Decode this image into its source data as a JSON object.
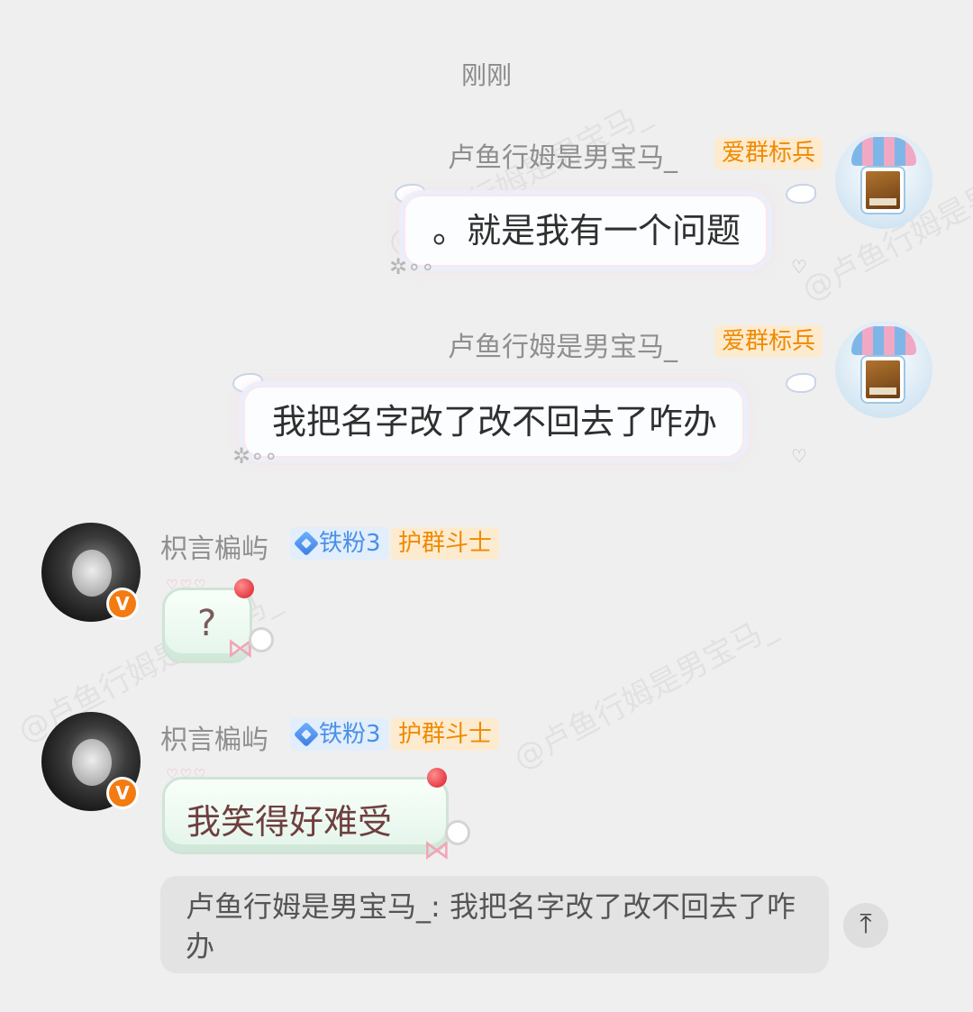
{
  "timestamp": "刚刚",
  "watermark": "@卢鱼行姆是男宝马_",
  "messages": [
    {
      "sender": "卢鱼行姆是男宝马_",
      "badge": "爱群标兵",
      "text": "。就是我有一个问题"
    },
    {
      "sender": "卢鱼行姆是男宝马_",
      "badge": "爱群标兵",
      "text": "我把名字改了改不回去了咋办"
    },
    {
      "sender": "枳言楄屿",
      "fan_badge": "铁粉3",
      "badge": "护群斗士",
      "sticker_text": "?"
    },
    {
      "sender": "枳言楄屿",
      "fan_badge": "铁粉3",
      "badge": "护群斗士",
      "text": "我笑得好难受"
    }
  ],
  "quote": {
    "text": "卢鱼行姆是男宝马_: 我把名字改了改不回去了咋办"
  },
  "icons": {
    "verified": "V",
    "scroll_top": "⤒"
  },
  "colors": {
    "background": "#efefef",
    "badge_orange": "#f08a00",
    "badge_blue": "#4a8fe8",
    "verified": "#f37b12"
  }
}
